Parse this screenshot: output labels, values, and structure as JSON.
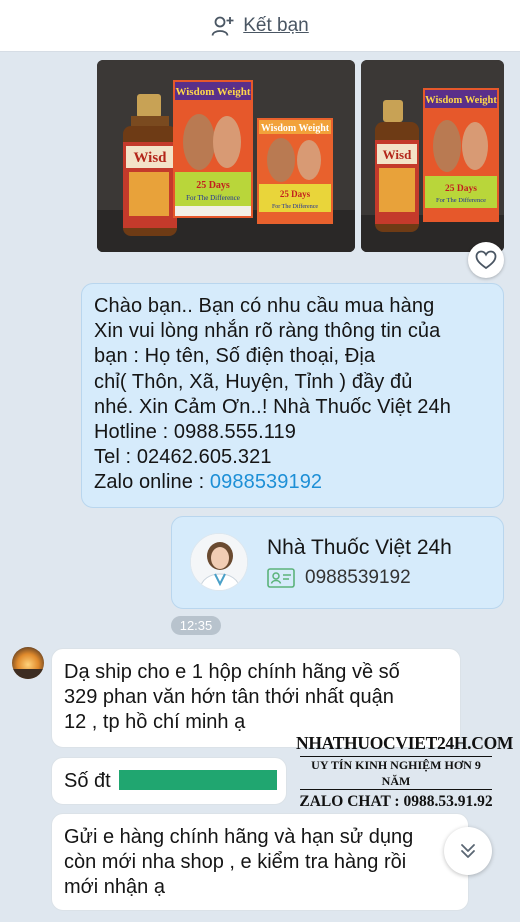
{
  "header": {
    "add_friend_label": "Kết bạn",
    "add_friend_icon": "add-person-icon"
  },
  "photos": [
    {
      "icon": "product-photo",
      "box_brand": "Wisdom Weight",
      "box_days": "25 Days",
      "box_tagline": "For The Difference",
      "bottle_brand": "Wisd"
    },
    {
      "icon": "product-photo",
      "box_brand": "Wisdom Weight",
      "box_days": "25 Days",
      "box_tagline": "For The Difference",
      "bottle_brand": "Wisd"
    }
  ],
  "reaction": {
    "icon": "heart-icon"
  },
  "outgoing_message": {
    "lines": [
      "Chào bạn.. Bạn có nhu cầu mua hàng",
      "Xin vui lòng nhắn rõ ràng thông tin của",
      "bạn : Họ tên, Số điện thoại, Địa",
      "chỉ( Thôn,  Xã, Huyện, Tỉnh ) đầy đủ",
      "nhé. Xin Cảm Ơn..! Nhà Thuốc Việt 24h",
      "Hotline : 0988.555.119",
      "Tel : 02462.605.321"
    ],
    "zalo_prefix": "Zalo online : ",
    "zalo_number": "0988539192"
  },
  "contact_card": {
    "name": "Nhà Thuốc Việt 24h",
    "phone": "0988539192",
    "id_icon": "id-card-icon"
  },
  "timestamp": "12:35",
  "incoming_messages": [
    {
      "lines": [
        "Dạ ship cho e 1 hộp chính hãng về số",
        "329 phan văn hớn tân thới nhất  quận",
        "12 , tp hồ chí minh ạ"
      ]
    },
    {
      "lines": [
        "Số đt"
      ],
      "redacted": true
    },
    {
      "lines": [
        "Gửi e hàng chính hãng và hạn sử dụng",
        "còn mới nha shop , e kiểm tra hàng rồi",
        "mới nhận ạ"
      ]
    }
  ],
  "watermark": {
    "site": "NHATHUOCVIET24H.COM",
    "tagline": "UY TÍN KINH NGHIỆM HƠN 9 NĂM",
    "zalo": "ZALO CHAT : 0988.53.91.92"
  },
  "scroll_button": {
    "icon": "double-chevron-down-icon"
  },
  "colors": {
    "chat_bg": "#dfe7ef",
    "outgoing_bg": "#d6ebfb",
    "link": "#1d8fd6",
    "redaction": "#20a670"
  }
}
